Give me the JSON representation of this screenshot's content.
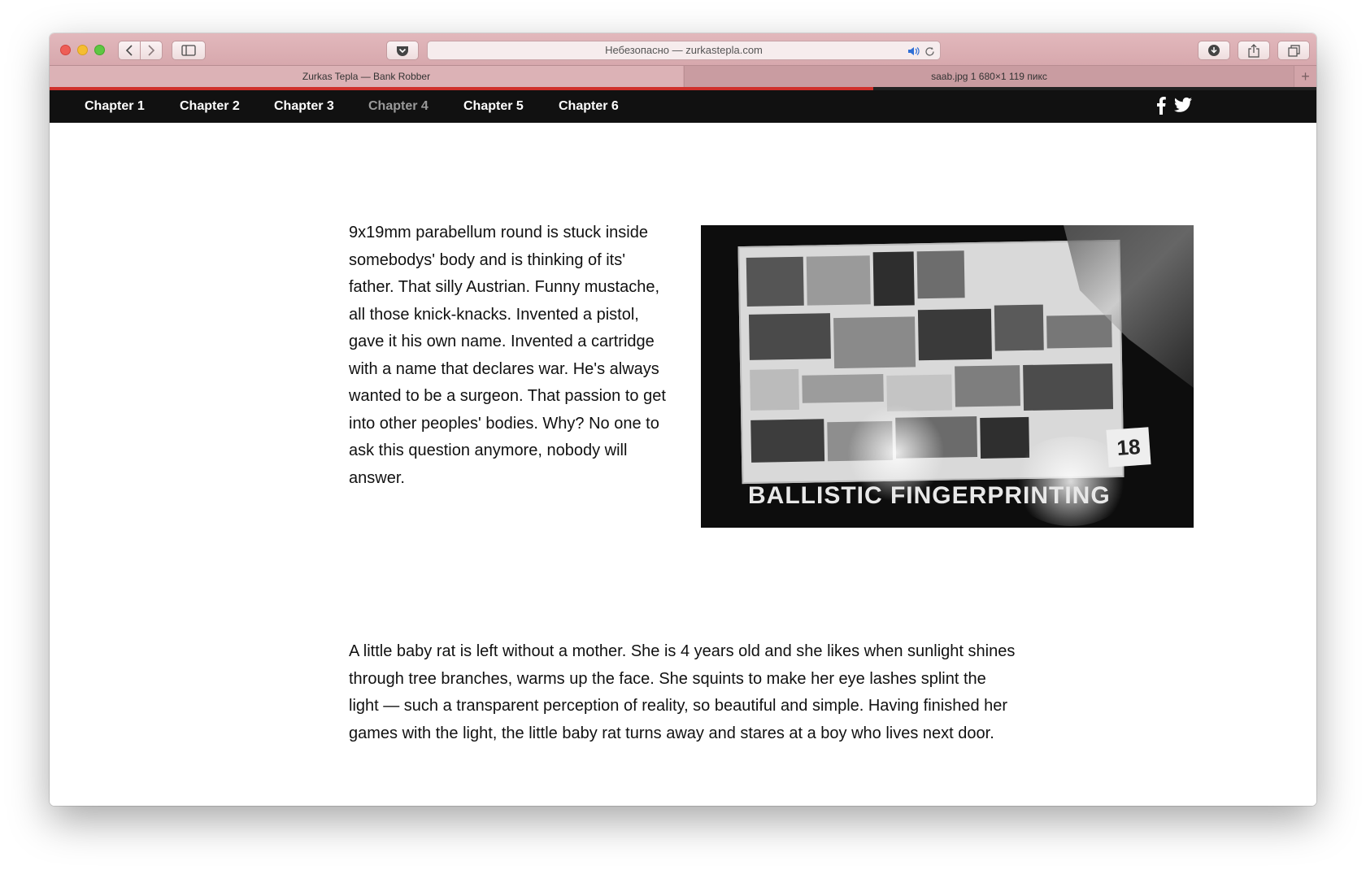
{
  "browser": {
    "address_text": "Небезопасно — zurkastepla.com",
    "tabs": [
      {
        "label": "Zurkas Tepla — Bank Robber"
      },
      {
        "label": "saab.jpg 1 680×1 119 пикс"
      }
    ],
    "new_tab_label": "+",
    "icons": {
      "back": "chevron-left-icon",
      "forward": "chevron-right-icon",
      "sidebar": "sidebar-icon",
      "pocket": "pocket-icon",
      "audio": "speaker-icon",
      "reload": "reload-icon",
      "download": "download-icon",
      "share": "share-icon",
      "tabs": "tabs-icon"
    },
    "page_load_progress": 0.65,
    "accent_color": "#d0302b"
  },
  "site_nav": {
    "chapters": [
      {
        "label": "Chapter 1"
      },
      {
        "label": "Chapter 2"
      },
      {
        "label": "Chapter 3"
      },
      {
        "label": "Chapter 4"
      },
      {
        "label": "Chapter 5"
      },
      {
        "label": "Chapter 6"
      }
    ],
    "current_chapter": "Chapter 4",
    "social": [
      "facebook-icon",
      "twitter-icon"
    ]
  },
  "content": {
    "paragraph_1": "9x19mm parabellum round is stuck inside somebodys' body and is thinking of its' father. That silly Austrian. Funny mustache, all those knick-knacks. Invented a pistol, gave it his own name. Invented a cartridge with a name that declares war. He's always wanted to be a surgeon. That passion to get into other peoples' bodies. Why? No one to ask this question anymore, nobody will answer.",
    "image_title": "BALLISTIC FINGERPRINTING",
    "image_number": "18",
    "paragraph_2": "A little baby rat is left without a mother. She is 4 years old and she likes when sunlight shines through tree branches, warms up the face. She squints to make her eye lashes splint the light — such a transparent perception of reality, so beautiful and simple. Having finished her games with the light, the little baby rat turns away and stares at a boy who lives next door."
  }
}
